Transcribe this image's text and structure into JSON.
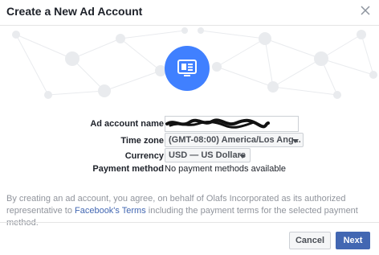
{
  "dialog": {
    "title": "Create a New Ad Account",
    "close_icon": "close-icon"
  },
  "hero": {
    "icon": "ad-account-icon",
    "accent": "#4080ff"
  },
  "form": {
    "ad_account_name": {
      "label": "Ad account name",
      "value": ""
    },
    "time_zone": {
      "label": "Time zone",
      "selected": "(GMT-08:00) America/Los Ang..."
    },
    "currency": {
      "label": "Currency",
      "selected": "USD — US Dollars"
    },
    "payment_method": {
      "label": "Payment method",
      "value": "No payment methods available"
    }
  },
  "terms": {
    "text_before": "By creating an ad account, you agree, on behalf of Olafs Incorporated as its authorized representative to ",
    "link": "Facebook's Terms",
    "text_after": " including the payment terms for the selected payment method."
  },
  "footer": {
    "cancel_label": "Cancel",
    "next_label": "Next"
  },
  "colors": {
    "primary": "#4267b2",
    "link": "#4267b2",
    "muted": "#90949c"
  }
}
